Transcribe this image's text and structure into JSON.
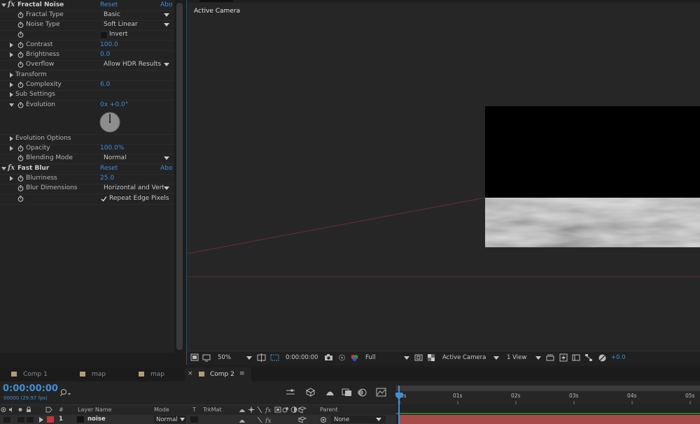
{
  "effects_panel": {
    "fractal_noise": {
      "name": "Fractal Noise",
      "reset": "Reset",
      "about": "Abo",
      "rows": {
        "fractal_type": {
          "label": "Fractal Type",
          "value": "Basic"
        },
        "noise_type": {
          "label": "Noise Type",
          "value": "Soft Linear"
        },
        "invert": {
          "label": "Invert"
        },
        "contrast": {
          "label": "Contrast",
          "value": "100.0"
        },
        "brightness": {
          "label": "Brightness",
          "value": "0.0"
        },
        "overflow": {
          "label": "Overflow",
          "value": "Allow HDR Results"
        },
        "transform": {
          "label": "Transform"
        },
        "complexity": {
          "label": "Complexity",
          "value": "6.0"
        },
        "sub_settings": {
          "label": "Sub Settings"
        },
        "evolution": {
          "label": "Evolution",
          "value": "0x +0.0°"
        },
        "evolution_options": {
          "label": "Evolution Options"
        },
        "opacity": {
          "label": "Opacity",
          "value": "100.0%"
        },
        "blending_mode": {
          "label": "Blending Mode",
          "value": "Normal"
        }
      }
    },
    "fast_blur": {
      "name": "Fast Blur",
      "reset": "Reset",
      "about": "Abo",
      "rows": {
        "blurriness": {
          "label": "Blurriness",
          "value": "25.0"
        },
        "blur_dimensions": {
          "label": "Blur Dimensions",
          "value": "Horizontal and Vertical"
        },
        "repeat_edge": {
          "label": "Repeat Edge Pixels",
          "checked": true
        }
      }
    }
  },
  "viewer": {
    "camera_label": "Active Camera",
    "toolbar": {
      "zoom": "50%",
      "timecode": "0:00:00:00",
      "resolution": "Full",
      "camera": "Active Camera",
      "views": "1 View",
      "exposure": "+0.0"
    }
  },
  "tabs": [
    {
      "label": "Comp 1",
      "active": false
    },
    {
      "label": "map",
      "active": false
    },
    {
      "label": "map",
      "active": false
    },
    {
      "label": "Comp 2",
      "active": true
    }
  ],
  "timeline": {
    "timecode": "0:00:00:00",
    "fps_label": "00000 (29.97 fps)",
    "ruler_ticks": [
      "0s",
      "01s",
      "02s",
      "03s",
      "04s",
      "05s"
    ],
    "columns": {
      "num": "#",
      "layer_name": "Layer Name",
      "mode": "Mode",
      "t": "T",
      "trkmat": "TrkMat",
      "parent": "Parent"
    },
    "layer": {
      "index": "1",
      "name": "noise",
      "mode": "Normal",
      "parent": "None",
      "label_color": "#c0393b"
    }
  },
  "colors": {
    "accent": "#3f8fd8",
    "layer_bar": "#a64a4a"
  }
}
